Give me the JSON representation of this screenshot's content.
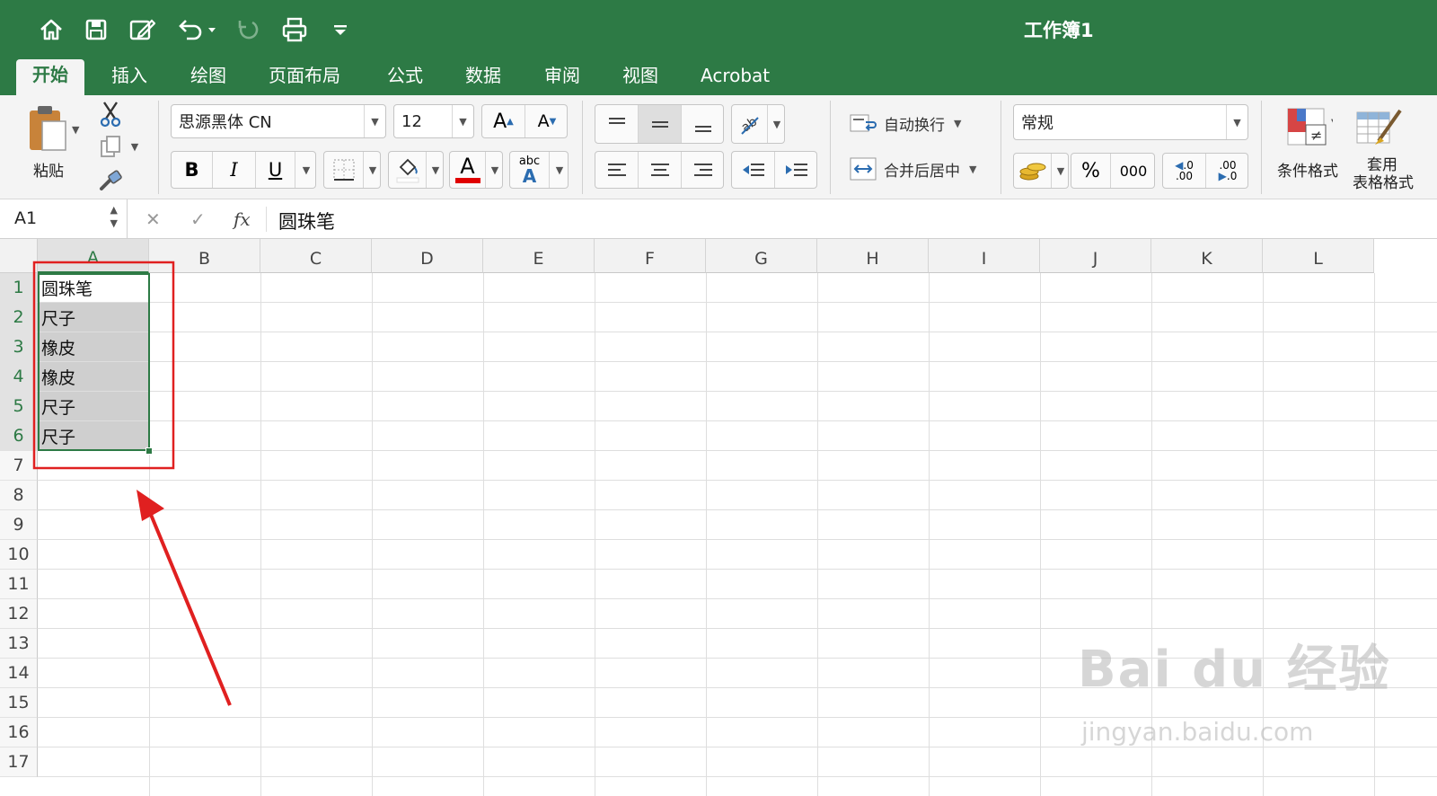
{
  "window": {
    "title": "工作簿1"
  },
  "quick_access": [
    "home-icon",
    "save-icon",
    "edit-icon",
    "undo-icon",
    "redo-icon",
    "print-icon",
    "customize-icon"
  ],
  "tabs": [
    {
      "label": "开始",
      "active": true
    },
    {
      "label": "插入"
    },
    {
      "label": "绘图"
    },
    {
      "label": "页面布局"
    },
    {
      "label": "公式"
    },
    {
      "label": "数据"
    },
    {
      "label": "审阅"
    },
    {
      "label": "视图"
    },
    {
      "label": "Acrobat"
    }
  ],
  "ribbon": {
    "paste_label": "粘贴",
    "font_name": "思源黑体 CN",
    "font_size": "12",
    "bold": "B",
    "italic": "I",
    "underline": "U",
    "font_color_letter": "A",
    "phonetic_abc": "abc",
    "phonetic_a": "A",
    "grow_font": "A",
    "shrink_font": "A",
    "wrap_text": "自动换行",
    "merge_center": "合并后居中",
    "number_format": "常规",
    "percent": "%",
    "thousands": "000",
    "inc_decimal_top": ".0",
    "inc_decimal_bottom": ".00",
    "dec_decimal_top": ".00",
    "dec_decimal_bottom": ".0",
    "conditional_format": "条件格式",
    "table_format_line1": "套用",
    "table_format_line2": "表格格式",
    "accent_red": "#e00000",
    "accent_green": "#2d7a45"
  },
  "formula_bar": {
    "name_box": "A1",
    "fx": "fx",
    "content": "圆珠笔"
  },
  "sheet": {
    "columns": [
      "A",
      "B",
      "C",
      "D",
      "E",
      "F",
      "G",
      "H",
      "I",
      "J",
      "K",
      "L"
    ],
    "rows": [
      "1",
      "2",
      "3",
      "4",
      "5",
      "6",
      "7",
      "8",
      "9",
      "10",
      "11",
      "12",
      "13",
      "14",
      "15",
      "16",
      "17"
    ],
    "cells_a": [
      "圆珠笔",
      "尺子",
      "橡皮",
      "橡皮",
      "尺子",
      "尺子"
    ],
    "selected_range": "A1:A6"
  },
  "annotation": {
    "box_color": "#e02020",
    "arrow_color": "#e02020"
  },
  "watermark": {
    "brand": "Bai du 经验",
    "url": "jingyan.baidu.com"
  }
}
